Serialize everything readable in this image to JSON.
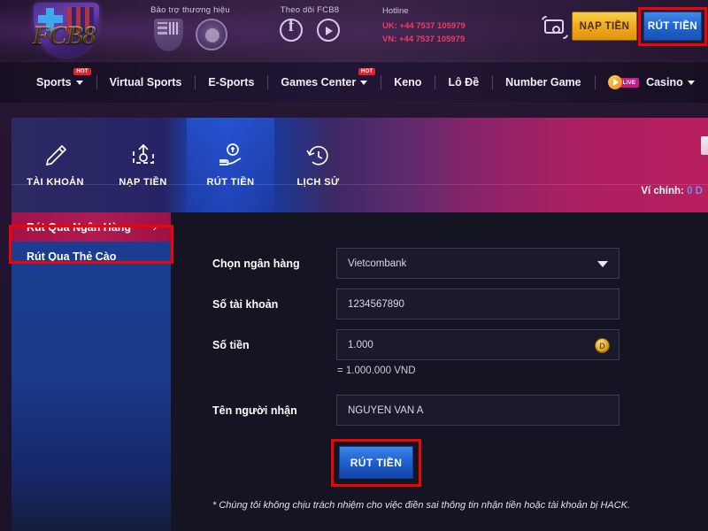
{
  "brand": {
    "logo_text": "FCB8"
  },
  "header": {
    "sponsor_caption": "Bảo trợ thương hiệu",
    "sponsor_logos": [
      "fcb-crest-icon",
      "iom-seal-icon"
    ],
    "social_caption": "Theo dõi FCB8",
    "social_icons": [
      "facebook-icon",
      "youtube-icon"
    ],
    "hotline_caption": "Hotline",
    "hotline_uk": "UK: +44 7537 105979",
    "hotline_vn": "VN: +44 7537 105979",
    "wallet_icon": "wallet-icon",
    "deposit_label": "NẠP TIỀN",
    "withdraw_label": "RÚT TIỀN",
    "accent_gold": "#efa81d",
    "accent_blue": "#1f63cf",
    "highlight_color": "#f00300"
  },
  "nav": {
    "items": [
      {
        "label": "Sports",
        "caret": true,
        "hot": "HOT"
      },
      {
        "label": "Virtual Sports",
        "caret": false,
        "hot": ""
      },
      {
        "label": "E-Sports",
        "caret": false,
        "hot": ""
      },
      {
        "label": "Games Center",
        "caret": true,
        "hot": "HOT"
      },
      {
        "label": "Keno",
        "caret": false,
        "hot": ""
      },
      {
        "label": "Lô Đề",
        "caret": false,
        "hot": ""
      },
      {
        "label": "Number Game",
        "caret": false,
        "hot": ""
      },
      {
        "label": "Casino",
        "caret": true,
        "hot": "",
        "live": "LIVE"
      }
    ]
  },
  "tabs": {
    "items": [
      {
        "label": "TÀI KHOẢN",
        "icon": "pencil-icon",
        "active": false
      },
      {
        "label": "NẠP TIỀN",
        "icon": "deposit-cash-icon",
        "active": false
      },
      {
        "label": "RÚT TIỀN",
        "icon": "withdraw-hand-icon",
        "active": true
      },
      {
        "label": "LỊCH SỬ",
        "icon": "history-clock-icon",
        "active": false
      }
    ],
    "wallet_label": "Ví chính:",
    "wallet_amount": "0 D"
  },
  "sidebar": {
    "items": [
      {
        "label": "Rút Qua Ngân Hàng",
        "active": true,
        "chevron": "›"
      },
      {
        "label": "Rút Qua Thẻ Cào",
        "active": false,
        "chevron": ""
      }
    ]
  },
  "form": {
    "bank_label": "Chọn ngân hàng",
    "bank_value": "Vietcombank",
    "account_label": "Số tài khoản",
    "account_value": "1234567890",
    "amount_label": "Số tiền",
    "amount_value": "1.000",
    "amount_coin": "D",
    "converted": "= 1.000.000 VND",
    "receiver_label": "Tên người nhận",
    "receiver_value": "NGUYEN VAN A",
    "submit_label": "RÚT TIỀN",
    "note": "* Chúng tôi không chịu trách nhiệm cho việc điền sai thông tin nhận tiền hoặc tài khoản bị HACK."
  }
}
